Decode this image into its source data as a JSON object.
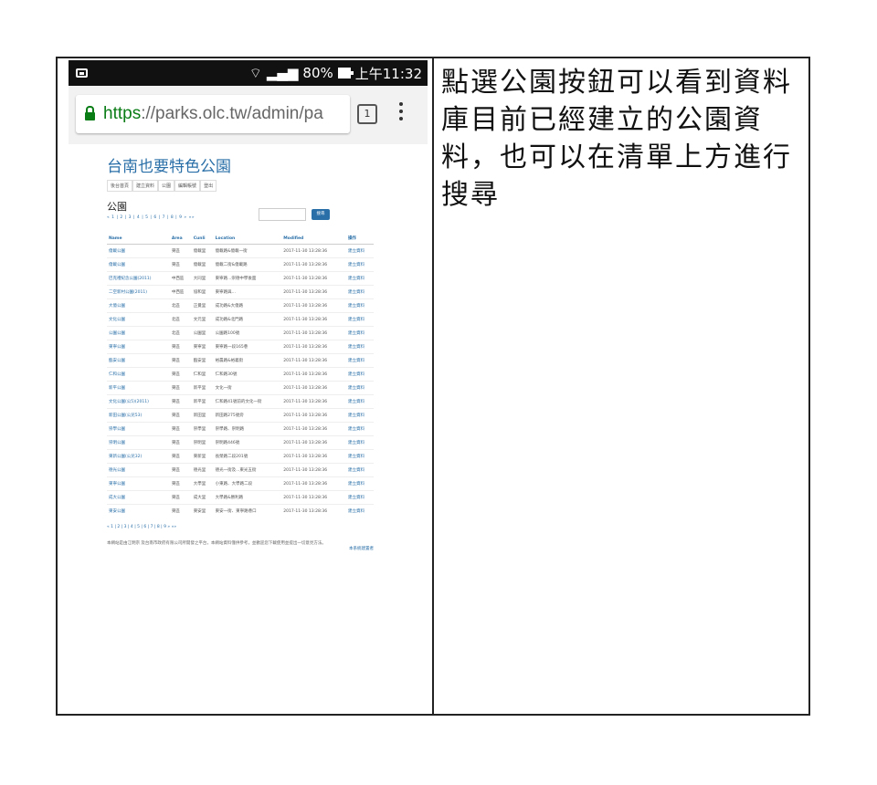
{
  "status_bar": {
    "battery": "80%",
    "time": "上午11:32"
  },
  "browser": {
    "url_scheme": "https",
    "url_rest": "://parks.olc.tw/admin/pa",
    "tab_count": "1"
  },
  "site": {
    "title": "台南也要特色公園",
    "nav": [
      "後台首頁",
      "建立資料",
      "公園",
      "編輯帳號",
      "登出"
    ],
    "page_heading": "公園",
    "pager_top": "« 1 | 2 | 3 | 4 | 5 | 6 | 7 | 8 | 9 » »»",
    "search_button": "搜尋",
    "columns": [
      "Name",
      "Area",
      "Cunli",
      "Location",
      "Modified",
      "操作"
    ],
    "rows": [
      [
        "億載公園",
        "東區",
        "億載里",
        "億載路&億載一街",
        "2017-11-30 13:28:36",
        "建立資料"
      ],
      [
        "億載公園",
        "東區",
        "億載里",
        "億載二街&億載路",
        "2017-11-30 13:28:36",
        "建立資料"
      ],
      [
        "巴克禮紀念公園(2011)",
        "中西區",
        "大同里",
        "東寧路...崇德中學後面",
        "2017-11-30 13:28:36",
        "建立資料"
      ],
      [
        "二空新村公園(2011)",
        "中西區",
        "協和里",
        "東寧路與...",
        "2017-11-30 13:28:36",
        "建立資料"
      ],
      [
        "大億公園",
        "北區",
        "正覺里",
        "成功路&大億路",
        "2017-11-30 13:28:36",
        "建立資料"
      ],
      [
        "文化公園",
        "北區",
        "文元里",
        "成功路&北門路",
        "2017-11-30 13:28:36",
        "建立資料"
      ],
      [
        "公園公園",
        "北區",
        "公園里",
        "公園路100號",
        "2017-11-30 13:28:36",
        "建立資料"
      ],
      [
        "東寧公園",
        "東區",
        "東寧里",
        "東寧路一段165巷",
        "2017-11-30 13:28:36",
        "建立資料"
      ],
      [
        "臨安公園",
        "東區",
        "臨安里",
        "裕農路&裕義街",
        "2017-11-30 13:28:36",
        "建立資料"
      ],
      [
        "仁和公園",
        "東區",
        "仁和里",
        "仁和路30號",
        "2017-11-30 13:28:36",
        "建立資料"
      ],
      [
        "新平公園",
        "東區",
        "新平里",
        "文化一街",
        "2017-11-30 13:28:36",
        "建立資料"
      ],
      [
        "文化公園(公5)(2011)",
        "東區",
        "新平里",
        "仁和路41號前的文化一街",
        "2017-11-30 13:28:36",
        "建立資料"
      ],
      [
        "新田公園(公兒53)",
        "東區",
        "新田里",
        "新田路275號旁",
        "2017-11-30 13:28:36",
        "建立資料"
      ],
      [
        "崇學公園",
        "東區",
        "崇學里",
        "崇學路、崇明路",
        "2017-11-30 13:28:36",
        "建立資料"
      ],
      [
        "崇明公園",
        "東區",
        "崇明里",
        "崇明路446號",
        "2017-11-30 13:28:36",
        "建立資料"
      ],
      [
        "東新公園(公兒32)",
        "東區",
        "東新里",
        "長榮路二段201號",
        "2017-11-30 13:28:36",
        "建立資料"
      ],
      [
        "德光公園",
        "東區",
        "德光里",
        "德光一街及...東光五街",
        "2017-11-30 13:28:36",
        "建立資料"
      ],
      [
        "東寧公園",
        "東區",
        "大學里",
        "小東路、大學路二段",
        "2017-11-30 13:28:36",
        "建立資料"
      ],
      [
        "成大公園",
        "東區",
        "成大里",
        "大學路&勝利路",
        "2017-11-30 13:28:36",
        "建立資料"
      ],
      [
        "東安公園",
        "東區",
        "東安里",
        "東安一街、東寧路巷口",
        "2017-11-30 13:28:36",
        "建立資料"
      ]
    ],
    "pager_bottom": "« 1 | 2 | 3 | 4 | 5 | 6 | 7 | 8 | 9 » »»",
    "footer_text": "本網站是由江明宗 及台南市政府有限公司所開發之平台，本網站資料僅供參考，並歡迎您下載使用並提出一切意見方法。",
    "footer_link": "本系統建置者"
  },
  "caption": "點選公園按鈕可以看到資料庫目前已經建立的公園資料，也可以在清單上方進行搜尋"
}
